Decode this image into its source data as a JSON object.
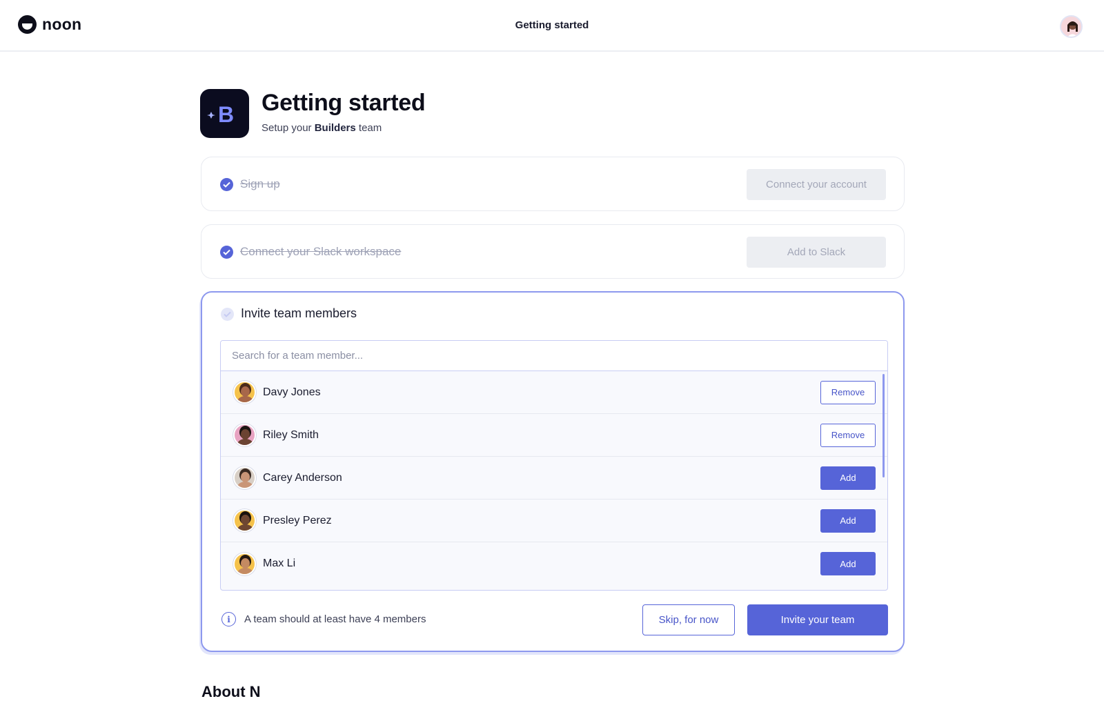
{
  "topbar": {
    "logo_text": "noon",
    "title": "Getting started"
  },
  "header": {
    "title": "Getting started",
    "subtitle_prefix": "Setup your",
    "subtitle_team": "Builders",
    "subtitle_suffix": "team",
    "app_icon_letter": "B"
  },
  "steps": [
    {
      "label": "Sign up",
      "status": "done",
      "action_label": "Connect your account"
    },
    {
      "label": "Connect your Slack workspace",
      "status": "done",
      "action_label": "Add to Slack"
    },
    {
      "label": "Invite team members",
      "status": "active"
    }
  ],
  "invite": {
    "search_placeholder": "Search for a team member...",
    "members": [
      {
        "name": "Davy Jones",
        "action": "Remove",
        "bg": "#f5c24b",
        "skin": "#a7674a",
        "hair": "#4a2a1a"
      },
      {
        "name": "Riley Smith",
        "action": "Remove",
        "bg": "#e8a3c2",
        "skin": "#6b4332",
        "hair": "#1d1613"
      },
      {
        "name": "Carey Anderson",
        "action": "Add",
        "bg": "#d8cfc6",
        "skin": "#c99577",
        "hair": "#3a2a22"
      },
      {
        "name": "Presley Perez",
        "action": "Add",
        "bg": "#f5c24b",
        "skin": "#6e4631",
        "hair": "#1a120e"
      },
      {
        "name": "Max Li",
        "action": "Add",
        "bg": "#f5c24b",
        "skin": "#c48a62",
        "hair": "#231813"
      }
    ],
    "hint": "A team should at least have 4 members",
    "skip_label": "Skip, for now",
    "invite_label": "Invite your team"
  },
  "footer": {
    "about_partial": "About N"
  },
  "colors": {
    "accent": "#5664d8",
    "accent_border": "#8d98ee",
    "disabled_bg": "#eceef2"
  }
}
